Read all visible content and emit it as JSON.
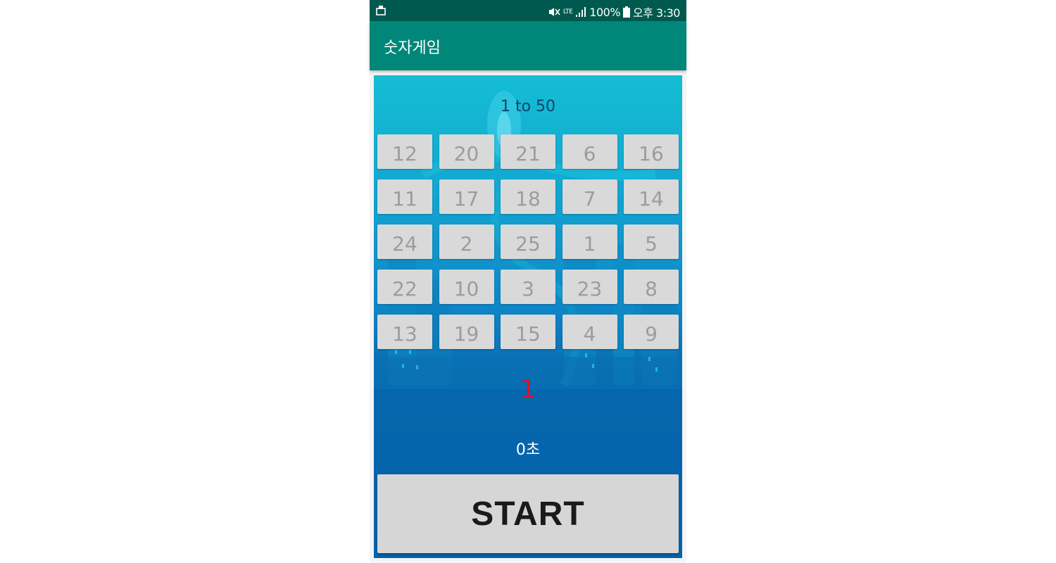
{
  "status_bar": {
    "signal_label": "LTE",
    "battery": "100%",
    "time": "오후 3:30"
  },
  "app_bar": {
    "title": "숫자게임"
  },
  "game": {
    "heading": "1 to 50",
    "tiles": [
      "12",
      "20",
      "21",
      "6",
      "16",
      "11",
      "17",
      "18",
      "7",
      "14",
      "24",
      "2",
      "25",
      "1",
      "5",
      "22",
      "10",
      "3",
      "23",
      "8",
      "13",
      "19",
      "15",
      "4",
      "9"
    ],
    "next_number": "1",
    "timer": "0초",
    "start_label": "START"
  },
  "colors": {
    "status_bar": "#00594e",
    "app_bar": "#00877a",
    "next_number": "#d7142c"
  }
}
